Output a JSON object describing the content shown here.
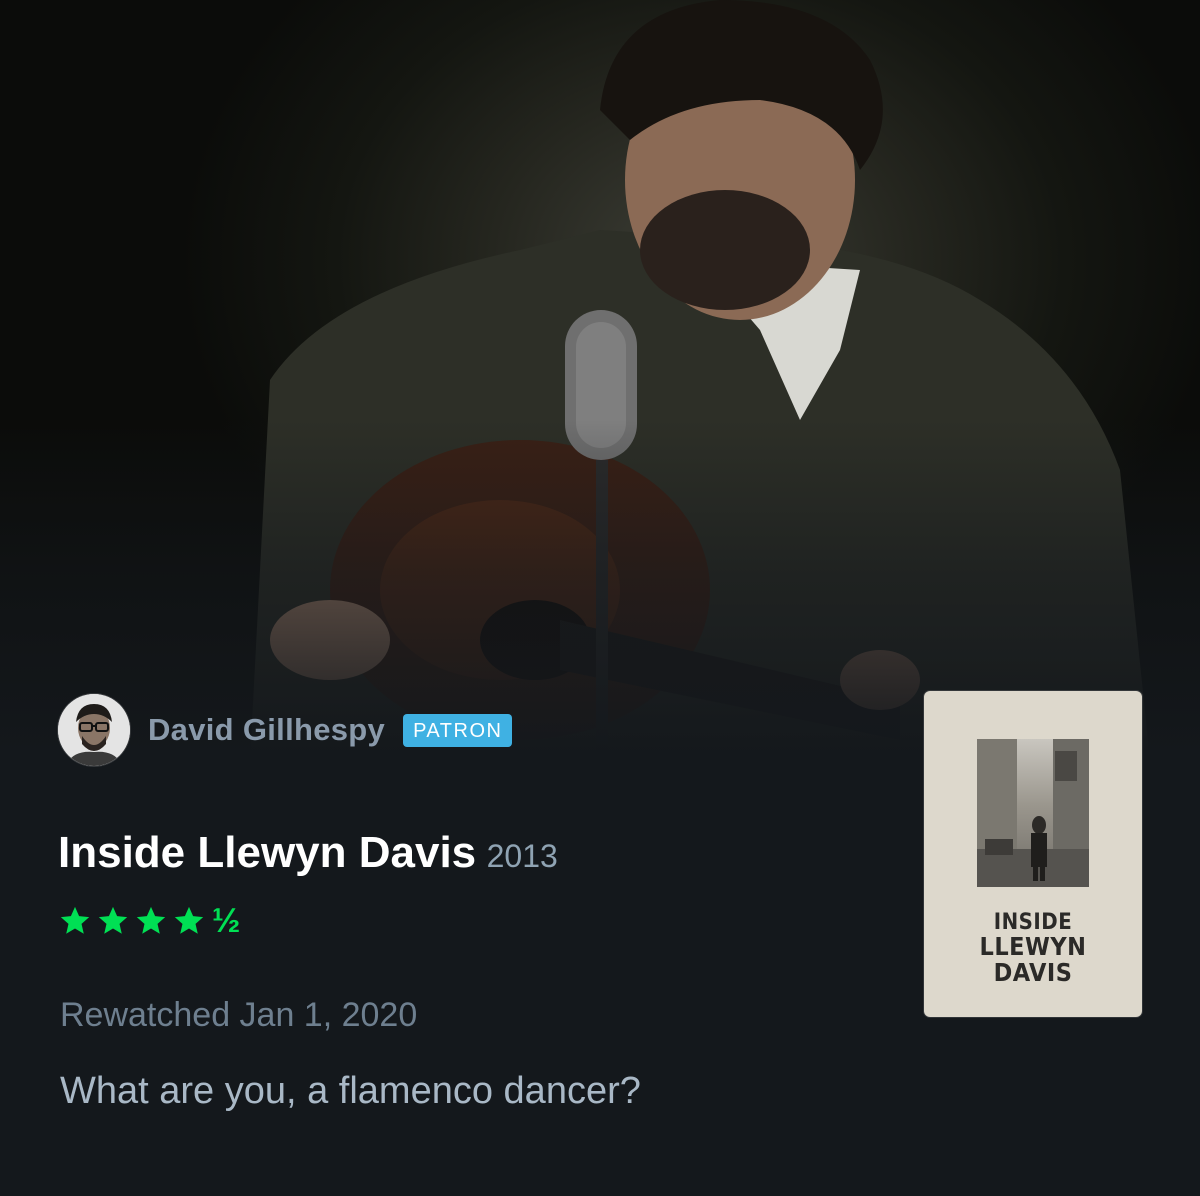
{
  "review": {
    "username": "David Gillhespy",
    "badge": "PATRON",
    "film_title": "Inside Llewyn Davis",
    "year": "2013",
    "rating": 4.5,
    "rating_half_glyph": "½",
    "watch_date": "Rewatched Jan 1, 2020",
    "text": "What are you, a flamenco dancer?"
  },
  "poster": {
    "title_line1": "INSIDE",
    "title_line2": "LLEWYN",
    "title_line3": "DAVIS"
  },
  "colors": {
    "background": "#14181c",
    "star_green": "#00e054",
    "badge_blue": "#3fb1e3",
    "username": "#8a9aab"
  },
  "icons": {
    "star": "star-icon",
    "avatar": "user-avatar"
  }
}
